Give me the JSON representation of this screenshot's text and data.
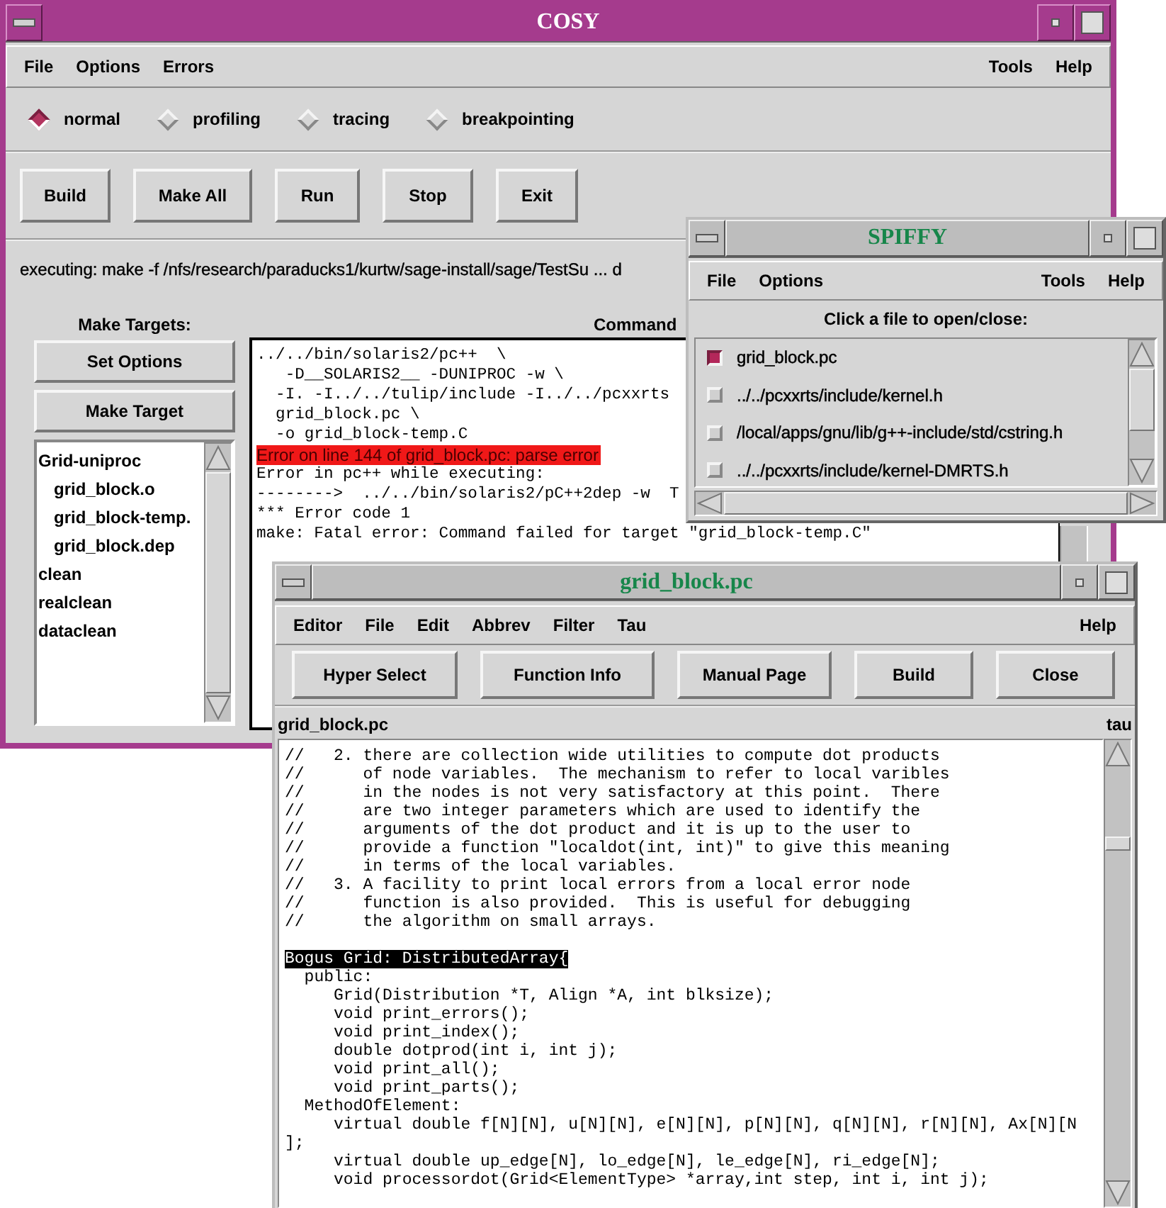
{
  "cosy": {
    "title": "COSY",
    "menu_left": [
      "File",
      "Options",
      "Errors"
    ],
    "menu_right": [
      "Tools",
      "Help"
    ],
    "modes": [
      {
        "label": "normal",
        "selected": true
      },
      {
        "label": "profiling",
        "selected": false
      },
      {
        "label": "tracing",
        "selected": false
      },
      {
        "label": "breakpointing",
        "selected": false
      }
    ],
    "buttons": [
      "Build",
      "Make All",
      "Run",
      "Stop",
      "Exit"
    ],
    "status": "executing:  make -f /nfs/research/paraducks1/kurtw/sage-install/sage/TestSu ... d",
    "targets_label": "Make Targets:",
    "target_buttons": [
      "Set Options",
      "Make Target"
    ],
    "targets": [
      {
        "label": "Grid-uniproc",
        "children": [
          {
            "label": "grid_block.o"
          },
          {
            "label": "grid_block-temp."
          },
          {
            "label": "grid_block.dep"
          }
        ]
      },
      {
        "label": "clean"
      },
      {
        "label": "realclean"
      },
      {
        "label": "dataclean"
      }
    ],
    "output_label": "Command",
    "output": [
      {
        "text": "../../bin/solaris2/pc++  \\",
        "kind": "plain"
      },
      {
        "text": "   -D__SOLARIS2__ -DUNIPROC -w \\",
        "kind": "plain"
      },
      {
        "text": "  -I. -I../../tulip/include -I../../pcxxrts",
        "kind": "plain"
      },
      {
        "text": "  grid_block.pc \\",
        "kind": "plain"
      },
      {
        "text": "  -o grid_block-temp.C",
        "kind": "plain"
      },
      {
        "text": "Error on line 144 of grid_block.pc: parse error",
        "kind": "error"
      },
      {
        "text": "Error in pc++ while executing:",
        "kind": "plain"
      },
      {
        "text": "-------->  ../../bin/solaris2/pC++2dep -w  T",
        "kind": "plain"
      },
      {
        "text": "*** Error code 1",
        "kind": "plain"
      },
      {
        "text": "make: Fatal error: Command failed for target \"grid_block-temp.C\"",
        "kind": "plain"
      }
    ]
  },
  "spiffy": {
    "title": "SPIFFY",
    "menu_left": [
      "File",
      "Options"
    ],
    "menu_right": [
      "Tools",
      "Help"
    ],
    "prompt": "Click a file to open/close:",
    "files": [
      {
        "name": "grid_block.pc",
        "open": true
      },
      {
        "name": "../../pcxxrts/include/kernel.h",
        "open": false
      },
      {
        "name": "/local/apps/gnu/lib/g++-include/std/cstring.h",
        "open": false
      },
      {
        "name": "../../pcxxrts/include/kernel-DMRTS.h",
        "open": false
      }
    ]
  },
  "editor": {
    "title": "grid_block.pc",
    "menu_left": [
      "Editor",
      "File",
      "Edit",
      "Abbrev",
      "Filter",
      "Tau"
    ],
    "menu_right": [
      "Help"
    ],
    "buttons": [
      "Hyper Select",
      "Function Info",
      "Manual Page",
      "Build",
      "Close"
    ],
    "file_label": "grid_block.pc",
    "mode_label": "tau",
    "comment_lines": [
      "//   2. there are collection wide utilities to compute dot products",
      "//      of node variables.  The mechanism to refer to local varibles",
      "//      in the nodes is not very satisfactory at this point.  There",
      "//      are two integer parameters which are used to identify the",
      "//      arguments of the dot product and it is up to the user to",
      "//      provide a function \"localdot(int, int)\" to give this meaning",
      "//      in terms of the local variables.",
      "//   3. A facility to print local errors from a local error node",
      "//      function is also provided.  This is useful for debugging",
      "//      the algorithm on small arrays."
    ],
    "code_lines": [
      {
        "text": "Bogus Grid: DistributedArray{",
        "highlighted": true
      },
      {
        "text": "  public:",
        "highlighted": false
      },
      {
        "text": "     Grid(Distribution *T, Align *A, int blksize);",
        "highlighted": false
      },
      {
        "text": "     void print_errors();",
        "highlighted": false
      },
      {
        "text": "     void print_index();",
        "highlighted": false
      },
      {
        "text": "     double dotprod(int i, int j);",
        "highlighted": false
      },
      {
        "text": "     void print_all();",
        "highlighted": false
      },
      {
        "text": "     void print_parts();",
        "highlighted": false
      },
      {
        "text": "  MethodOfElement:",
        "highlighted": false
      },
      {
        "text": "     virtual double f[N][N], u[N][N], e[N][N], p[N][N], q[N][N], r[N][N], Ax[N][N",
        "highlighted": false
      },
      {
        "text": "];",
        "highlighted": false
      },
      {
        "text": "     virtual double up_edge[N], lo_edge[N], le_edge[N], ri_edge[N];",
        "highlighted": false
      },
      {
        "text": "     void processordot(Grid<ElementType> *array,int step, int i, int j);",
        "highlighted": false
      }
    ]
  }
}
